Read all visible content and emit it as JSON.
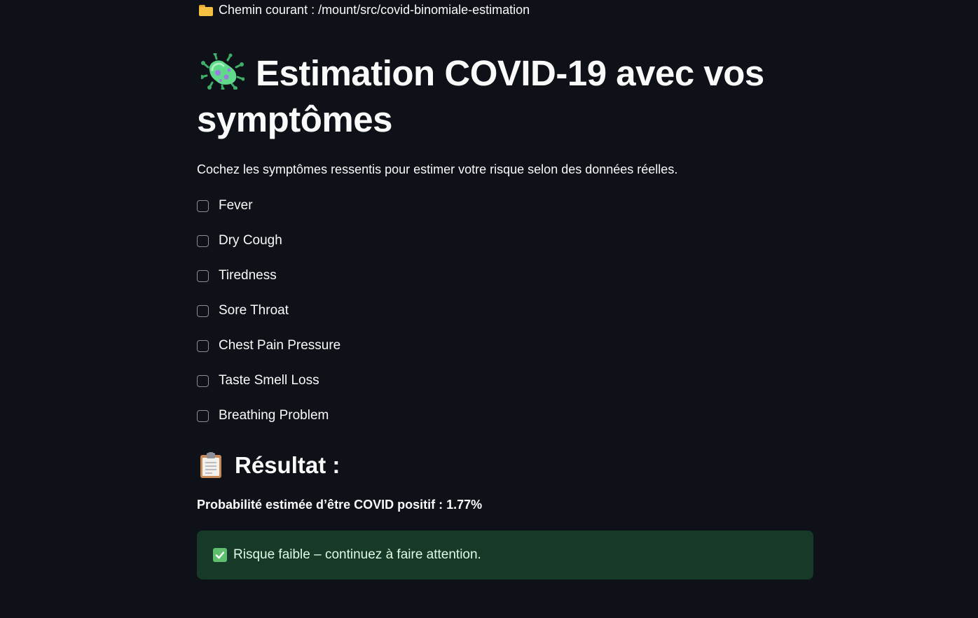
{
  "header": {
    "path_icon": "folder-icon",
    "path_text": "Chemin courant : /mount/src/covid-binomiale-estimation"
  },
  "page": {
    "title_icon": "microbe-icon",
    "title": "Estimation COVID-19 avec vos symptômes",
    "subtitle": "Cochez les symptômes ressentis pour estimer votre risque selon des données réelles."
  },
  "symptoms": [
    {
      "label": "Fever",
      "checked": false
    },
    {
      "label": "Dry Cough",
      "checked": false
    },
    {
      "label": "Tiredness",
      "checked": false
    },
    {
      "label": "Sore Throat",
      "checked": false
    },
    {
      "label": "Chest Pain Pressure",
      "checked": false
    },
    {
      "label": "Taste Smell Loss",
      "checked": false
    },
    {
      "label": "Breathing Problem",
      "checked": false
    }
  ],
  "result": {
    "heading_icon": "clipboard-icon",
    "heading": "Résultat :",
    "probability_text": "Probabilité estimée d’être COVID positif : 1.77%",
    "alert_icon": "check-mark-icon",
    "alert_text": "Risque faible – continuez à faire attention."
  },
  "colors": {
    "background": "#0e1117",
    "text": "#fafafa",
    "success_bg": "#173928",
    "success_text": "#dffbe3",
    "success_icon": "#5fbf6f"
  }
}
